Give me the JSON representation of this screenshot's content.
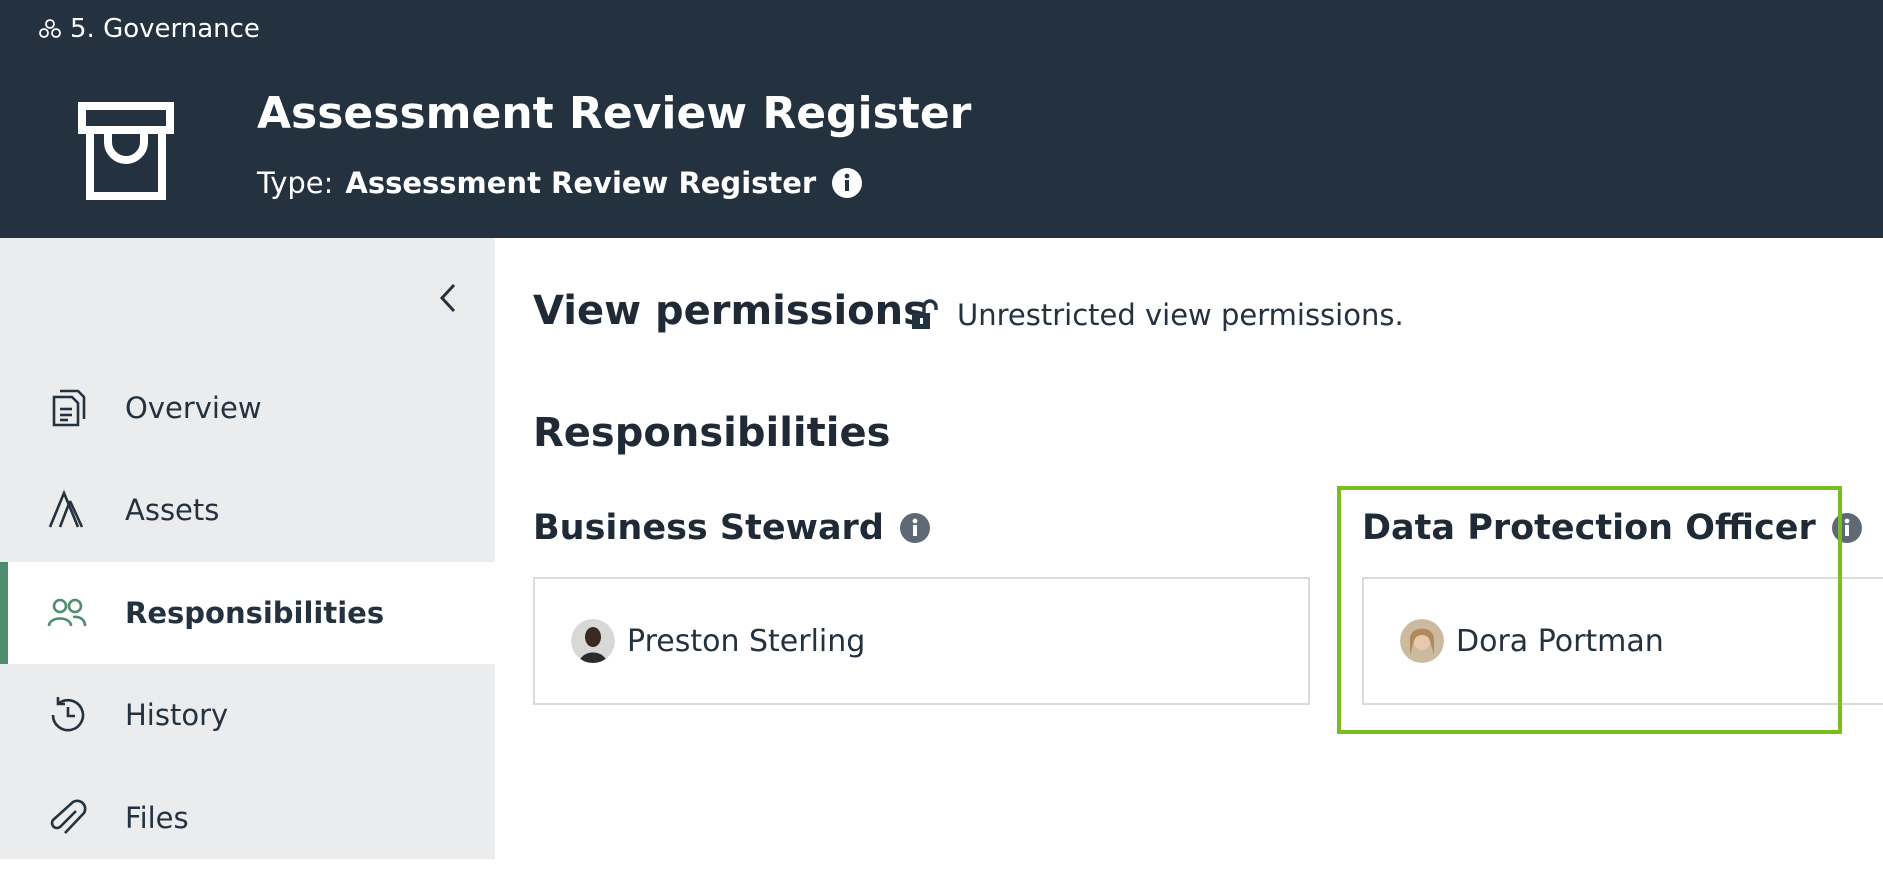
{
  "header": {
    "breadcrumb": "5. Governance",
    "asset_title": "Assessment Review Register",
    "type_label": "Type:",
    "type_value": "Assessment Review Register"
  },
  "sidebar": {
    "items": [
      {
        "label": "Overview",
        "icon": "document-icon"
      },
      {
        "label": "Assets",
        "icon": "assets-icon"
      },
      {
        "label": "Responsibilities",
        "icon": "people-icon",
        "active": true
      },
      {
        "label": "History",
        "icon": "history-icon"
      },
      {
        "label": "Files",
        "icon": "paperclip-icon"
      }
    ]
  },
  "main": {
    "view_permissions_heading": "View permissions",
    "view_permissions_status": "Unrestricted view permissions.",
    "responsibilities_heading": "Responsibilities",
    "roles": [
      {
        "title": "Business Steward",
        "user": "Preston Sterling"
      },
      {
        "title": "Data Protection Officer",
        "user": "Dora Portman"
      }
    ]
  },
  "colors": {
    "header_bg": "#24313e",
    "sidebar_bg": "#ebecee",
    "active_accent": "#4e8d6d",
    "highlight": "#79bd1f"
  }
}
